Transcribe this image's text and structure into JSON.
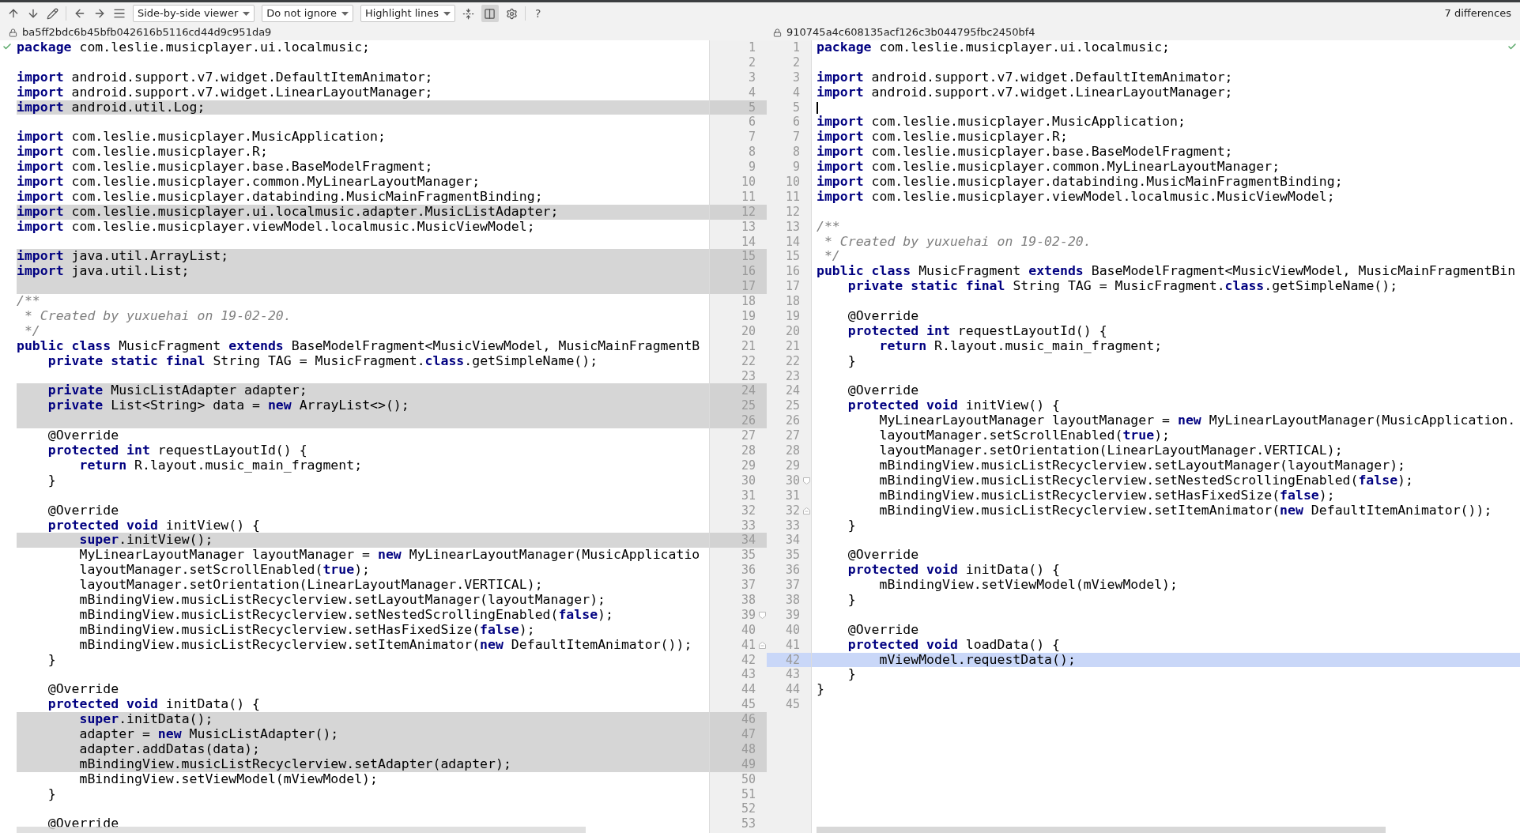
{
  "toolbar": {
    "dropdowns": [
      {
        "label": "Side-by-side viewer"
      },
      {
        "label": "Do not ignore"
      },
      {
        "label": "Highlight lines"
      }
    ],
    "layout_toggle": {
      "selected": true
    },
    "help": "?",
    "differences": "7 differences"
  },
  "left": {
    "revision": "ba5ff2bdc6b45bfb042616b5116cd44d9c951da9",
    "lines": [
      {
        "n": "1",
        "text": "**package** com.leslie.musicplayer.ui.localmusic;",
        "changed": false
      },
      {
        "n": "2",
        "changed": false
      },
      {
        "n": "3",
        "text": "**import** android.support.v7.widget.DefaultItemAnimator;",
        "changed": false
      },
      {
        "n": "4",
        "text": "**import** android.support.v7.widget.LinearLayoutManager;",
        "changed": false
      },
      {
        "n": "5",
        "text": "**import** android.util.Log;",
        "changed": true
      },
      {
        "n": "6",
        "changed": false
      },
      {
        "n": "7",
        "text": "**import** com.leslie.musicplayer.MusicApplication;",
        "changed": false
      },
      {
        "n": "8",
        "text": "**import** com.leslie.musicplayer.R;",
        "changed": false
      },
      {
        "n": "9",
        "text": "**import** com.leslie.musicplayer.base.BaseModelFragment;",
        "changed": false
      },
      {
        "n": "10",
        "text": "**import** com.leslie.musicplayer.common.MyLinearLayoutManager;",
        "changed": false
      },
      {
        "n": "11",
        "text": "**import** com.leslie.musicplayer.databinding.MusicMainFragmentBinding;",
        "changed": false
      },
      {
        "n": "12",
        "text": "**import** com.leslie.musicplayer.ui.localmusic.adapter.MusicListAdapter;",
        "changed": true
      },
      {
        "n": "13",
        "text": "**import** com.leslie.musicplayer.viewModel.localmusic.MusicViewModel;",
        "changed": false
      },
      {
        "n": "14",
        "changed": false
      },
      {
        "n": "15",
        "text": "**import** java.util.ArrayList;",
        "changed": true
      },
      {
        "n": "16",
        "text": "**import** java.util.List;",
        "changed": true
      },
      {
        "n": "17",
        "changed": true
      },
      {
        "n": "18",
        "text": "/**",
        "kind": "comment",
        "changed": false
      },
      {
        "n": "19",
        "text": " * Created by yuxuehai on 19-02-20.",
        "kind": "comment",
        "changed": false
      },
      {
        "n": "20",
        "text": " */",
        "kind": "comment",
        "changed": false
      },
      {
        "n": "21",
        "text": "**public** **class** MusicFragment **extends** BaseModelFragment<MusicViewModel, MusicMainFragmentB",
        "changed": false
      },
      {
        "n": "22",
        "text": "    **private** **static** **final** String TAG = MusicFragment.**class**.getSimpleName();",
        "changed": false
      },
      {
        "n": "23",
        "changed": false
      },
      {
        "n": "24",
        "text": "    **private** MusicListAdapter adapter;",
        "changed": true
      },
      {
        "n": "25",
        "text": "    **private** List<String> data = **new** ArrayList<>();",
        "changed": true
      },
      {
        "n": "26",
        "changed": true
      },
      {
        "n": "27",
        "text": "    @Override",
        "changed": false
      },
      {
        "n": "28",
        "text": "    **protected** **int** requestLayoutId() {",
        "changed": false
      },
      {
        "n": "29",
        "text": "        **return** R.layout.music_main_fragment;",
        "changed": false
      },
      {
        "n": "30",
        "text": "    }",
        "changed": false
      },
      {
        "n": "31",
        "changed": false
      },
      {
        "n": "32",
        "text": "    @Override",
        "changed": false
      },
      {
        "n": "33",
        "text": "    **protected** **void** initView() {",
        "changed": false
      },
      {
        "n": "34",
        "text": "        **super**.initView();",
        "changed": true
      },
      {
        "n": "35",
        "text": "        MyLinearLayoutManager layoutManager = **new** MyLinearLayoutManager(MusicApplicatio",
        "changed": false
      },
      {
        "n": "36",
        "text": "        layoutManager.setScrollEnabled(**true**);",
        "changed": false
      },
      {
        "n": "37",
        "text": "        layoutManager.setOrientation(LinearLayoutManager.VERTICAL);",
        "changed": false
      },
      {
        "n": "38",
        "text": "        mBindingView.musicListRecyclerview.setLayoutManager(layoutManager);",
        "changed": false
      },
      {
        "n": "39",
        "text": "        mBindingView.musicListRecyclerview.setNestedScrollingEnabled(**false**);",
        "changed": false,
        "fold_start": true
      },
      {
        "n": "40",
        "text": "        mBindingView.musicListRecyclerview.setHasFixedSize(**false**);",
        "changed": false
      },
      {
        "n": "41",
        "text": "        mBindingView.musicListRecyclerview.setItemAnimator(**new** DefaultItemAnimator());",
        "changed": false,
        "fold_end": true
      },
      {
        "n": "42",
        "text": "    }",
        "changed": false
      },
      {
        "n": "43",
        "changed": false
      },
      {
        "n": "44",
        "text": "    @Override",
        "changed": false
      },
      {
        "n": "45",
        "text": "    **protected** **void** initData() {",
        "changed": false
      },
      {
        "n": "46",
        "text": "        **super**.initData();",
        "changed": true
      },
      {
        "n": "47",
        "text": "        adapter = **new** MusicListAdapter();",
        "changed": true
      },
      {
        "n": "48",
        "text": "        adapter.addDatas(data);",
        "changed": true
      },
      {
        "n": "49",
        "text": "        mBindingView.musicListRecyclerview.setAdapter(adapter);",
        "changed": true
      },
      {
        "n": "50",
        "text": "        mBindingView.setViewModel(mViewModel);",
        "changed": false
      },
      {
        "n": "51",
        "text": "    }",
        "changed": false
      },
      {
        "n": "52",
        "changed": false
      },
      {
        "n": "53",
        "text": "    @Override",
        "changed": false
      }
    ]
  },
  "right": {
    "revision": "910745a4c608135acf126c3b044795fbc2450bf4",
    "lines": [
      {
        "n": "1",
        "text": "**package** com.leslie.musicplayer.ui.localmusic;",
        "changed": false
      },
      {
        "n": "2",
        "changed": false
      },
      {
        "n": "3",
        "text": "**import** android.support.v7.widget.DefaultItemAnimator;",
        "changed": false
      },
      {
        "n": "4",
        "text": "**import** android.support.v7.widget.LinearLayoutManager;",
        "changed": false
      },
      {
        "n": "5",
        "changed": false,
        "cursor": true
      },
      {
        "n": "6",
        "text": "**import** com.leslie.musicplayer.MusicApplication;",
        "changed": false
      },
      {
        "n": "7",
        "text": "**import** com.leslie.musicplayer.R;",
        "changed": false
      },
      {
        "n": "8",
        "text": "**import** com.leslie.musicplayer.base.BaseModelFragment;",
        "changed": false
      },
      {
        "n": "9",
        "text": "**import** com.leslie.musicplayer.common.MyLinearLayoutManager;",
        "changed": false
      },
      {
        "n": "10",
        "text": "**import** com.leslie.musicplayer.databinding.MusicMainFragmentBinding;",
        "changed": false
      },
      {
        "n": "11",
        "text": "**import** com.leslie.musicplayer.viewModel.localmusic.MusicViewModel;",
        "changed": false
      },
      {
        "n": "12",
        "changed": false
      },
      {
        "n": "13",
        "text": "/**",
        "kind": "comment",
        "changed": false
      },
      {
        "n": "14",
        "text": " * Created by yuxuehai on 19-02-20.",
        "kind": "comment",
        "changed": false
      },
      {
        "n": "15",
        "text": " */",
        "kind": "comment",
        "changed": false
      },
      {
        "n": "16",
        "text": "**public** **class** MusicFragment **extends** BaseModelFragment<MusicViewModel, MusicMainFragmentBin",
        "changed": false
      },
      {
        "n": "17",
        "text": "    **private** **static** **final** String TAG = MusicFragment.**class**.getSimpleName();",
        "changed": false
      },
      {
        "n": "18",
        "changed": false
      },
      {
        "n": "19",
        "text": "    @Override",
        "changed": false
      },
      {
        "n": "20",
        "text": "    **protected** **int** requestLayoutId() {",
        "changed": false
      },
      {
        "n": "21",
        "text": "        **return** R.layout.music_main_fragment;",
        "changed": false
      },
      {
        "n": "22",
        "text": "    }",
        "changed": false
      },
      {
        "n": "23",
        "changed": false
      },
      {
        "n": "24",
        "text": "    @Override",
        "changed": false
      },
      {
        "n": "25",
        "text": "    **protected** **void** initView() {",
        "changed": false
      },
      {
        "n": "26",
        "text": "        MyLinearLayoutManager layoutManager = **new** MyLinearLayoutManager(MusicApplication.",
        "changed": false
      },
      {
        "n": "27",
        "text": "        layoutManager.setScrollEnabled(**true**);",
        "changed": false
      },
      {
        "n": "28",
        "text": "        layoutManager.setOrientation(LinearLayoutManager.VERTICAL);",
        "changed": false
      },
      {
        "n": "29",
        "text": "        mBindingView.musicListRecyclerview.setLayoutManager(layoutManager);",
        "changed": false
      },
      {
        "n": "30",
        "text": "        mBindingView.musicListRecyclerview.setNestedScrollingEnabled(**false**);",
        "changed": false,
        "fold_start": true
      },
      {
        "n": "31",
        "text": "        mBindingView.musicListRecyclerview.setHasFixedSize(**false**);",
        "changed": false
      },
      {
        "n": "32",
        "text": "        mBindingView.musicListRecyclerview.setItemAnimator(**new** DefaultItemAnimator());",
        "changed": false,
        "fold_end": true
      },
      {
        "n": "33",
        "text": "    }",
        "changed": false
      },
      {
        "n": "34",
        "changed": false
      },
      {
        "n": "35",
        "text": "    @Override",
        "changed": false
      },
      {
        "n": "36",
        "text": "    **protected** **void** initData() {",
        "changed": false
      },
      {
        "n": "37",
        "text": "        mBindingView.setViewModel(mViewModel);",
        "changed": false
      },
      {
        "n": "38",
        "text": "    }",
        "changed": false
      },
      {
        "n": "39",
        "changed": false
      },
      {
        "n": "40",
        "text": "    @Override",
        "changed": false
      },
      {
        "n": "41",
        "text": "    **protected** **void** loadData() {",
        "changed": false
      },
      {
        "n": "42",
        "text": "        mViewModel.requestData();",
        "changed": true
      },
      {
        "n": "43",
        "text": "    }",
        "changed": false
      },
      {
        "n": "44",
        "text": "}",
        "changed": false
      },
      {
        "n": "45",
        "changed": false
      }
    ]
  }
}
